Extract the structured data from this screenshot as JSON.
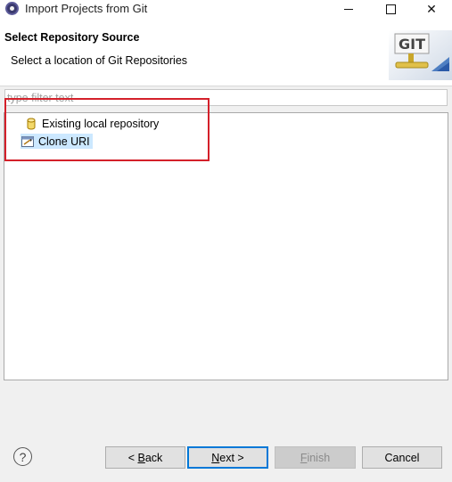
{
  "window": {
    "title": "Import Projects from Git"
  },
  "header": {
    "title": "Select Repository Source",
    "description": "Select a location of Git Repositories",
    "logo_text": "GIT"
  },
  "filter": {
    "placeholder": "type filter text",
    "value": ""
  },
  "tree": {
    "items": [
      {
        "label": "Existing local repository",
        "icon": "repository-cylinder-icon",
        "selected": false
      },
      {
        "label": "Clone URI",
        "icon": "clone-uri-icon",
        "selected": true
      }
    ]
  },
  "buttons": {
    "back_prefix": "< ",
    "back_mnemonic": "B",
    "back_rest": "ack",
    "next_mnemonic": "N",
    "next_rest": "ext >",
    "finish_mnemonic": "F",
    "finish_rest": "inish",
    "cancel": "Cancel",
    "help": "?"
  },
  "colors": {
    "selection": "#cce8ff",
    "annotation": "#d4202a",
    "default_button_border": "#0078d7"
  }
}
